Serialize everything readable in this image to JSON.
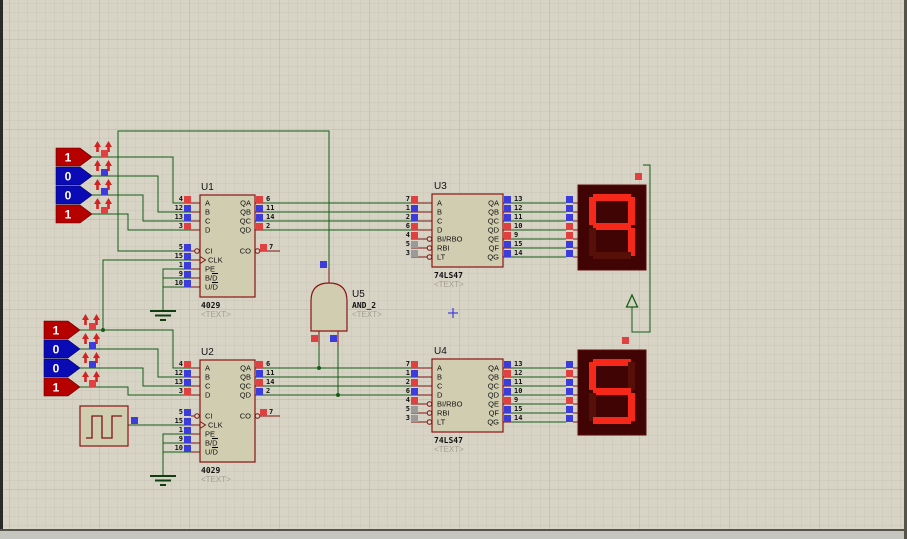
{
  "chips": {
    "u1": {
      "ref": "U1",
      "part": "4029",
      "placeholder": "<TEXT>"
    },
    "u2": {
      "ref": "U2",
      "part": "4029",
      "placeholder": "<TEXT>"
    },
    "u3": {
      "ref": "U3",
      "part": "74LS47",
      "placeholder": "<TEXT>"
    },
    "u4": {
      "ref": "U4",
      "part": "74LS47",
      "placeholder": "<TEXT>"
    },
    "u5": {
      "ref": "U5",
      "part": "AND_2",
      "placeholder": "<TEXT>"
    }
  },
  "counter_pins": {
    "left": [
      {
        "num": "4",
        "label": "A"
      },
      {
        "num": "12",
        "label": "B"
      },
      {
        "num": "13",
        "label": "C"
      },
      {
        "num": "3",
        "label": "D"
      },
      {
        "num": "5",
        "label": "CI"
      },
      {
        "num": "15",
        "label": "CLK"
      },
      {
        "num": "1",
        "label": "PE"
      },
      {
        "num": "9",
        "label": "B/D"
      },
      {
        "num": "10",
        "label": "U/D"
      }
    ],
    "right": [
      {
        "num": "6",
        "label": "QA"
      },
      {
        "num": "11",
        "label": "QB"
      },
      {
        "num": "14",
        "label": "QC"
      },
      {
        "num": "2",
        "label": "QD"
      },
      {
        "num": "7",
        "label": "CO"
      }
    ]
  },
  "decoder_pins": {
    "left": [
      {
        "num": "7",
        "label": "A"
      },
      {
        "num": "1",
        "label": "B"
      },
      {
        "num": "2",
        "label": "C"
      },
      {
        "num": "6",
        "label": "D"
      },
      {
        "num": "4",
        "label": "BI/RBO"
      },
      {
        "num": "5",
        "label": "RBI"
      },
      {
        "num": "3",
        "label": "LT"
      }
    ],
    "right": [
      {
        "num": "13",
        "label": "QA"
      },
      {
        "num": "12",
        "label": "QB"
      },
      {
        "num": "11",
        "label": "QC"
      },
      {
        "num": "10",
        "label": "QD"
      },
      {
        "num": "9",
        "label": "QE"
      },
      {
        "num": "15",
        "label": "QF"
      },
      {
        "num": "14",
        "label": "QG"
      }
    ]
  },
  "inputs": {
    "upper": {
      "values": [
        "1",
        "0",
        "0",
        "1"
      ]
    },
    "lower": {
      "values": [
        "1",
        "0",
        "0",
        "1"
      ]
    }
  },
  "displays": {
    "upper": {
      "digit": "9",
      "segments_lit": [
        "a",
        "b",
        "c",
        "f",
        "g"
      ]
    },
    "lower": {
      "digit": "5",
      "segments_lit": [
        "a",
        "c",
        "d",
        "f",
        "g"
      ]
    }
  },
  "colors": {
    "wire": "#155c15",
    "pin": "#7c1414",
    "logic_high": "#e04040",
    "logic_low": "#3c3cdc",
    "floating": "#9a9a9a",
    "tag_high": "#b60000",
    "tag_low": "#0b0bb6",
    "segment_lit": "#f52819",
    "segment_unlit": "#561008",
    "display_body": "#400404"
  }
}
